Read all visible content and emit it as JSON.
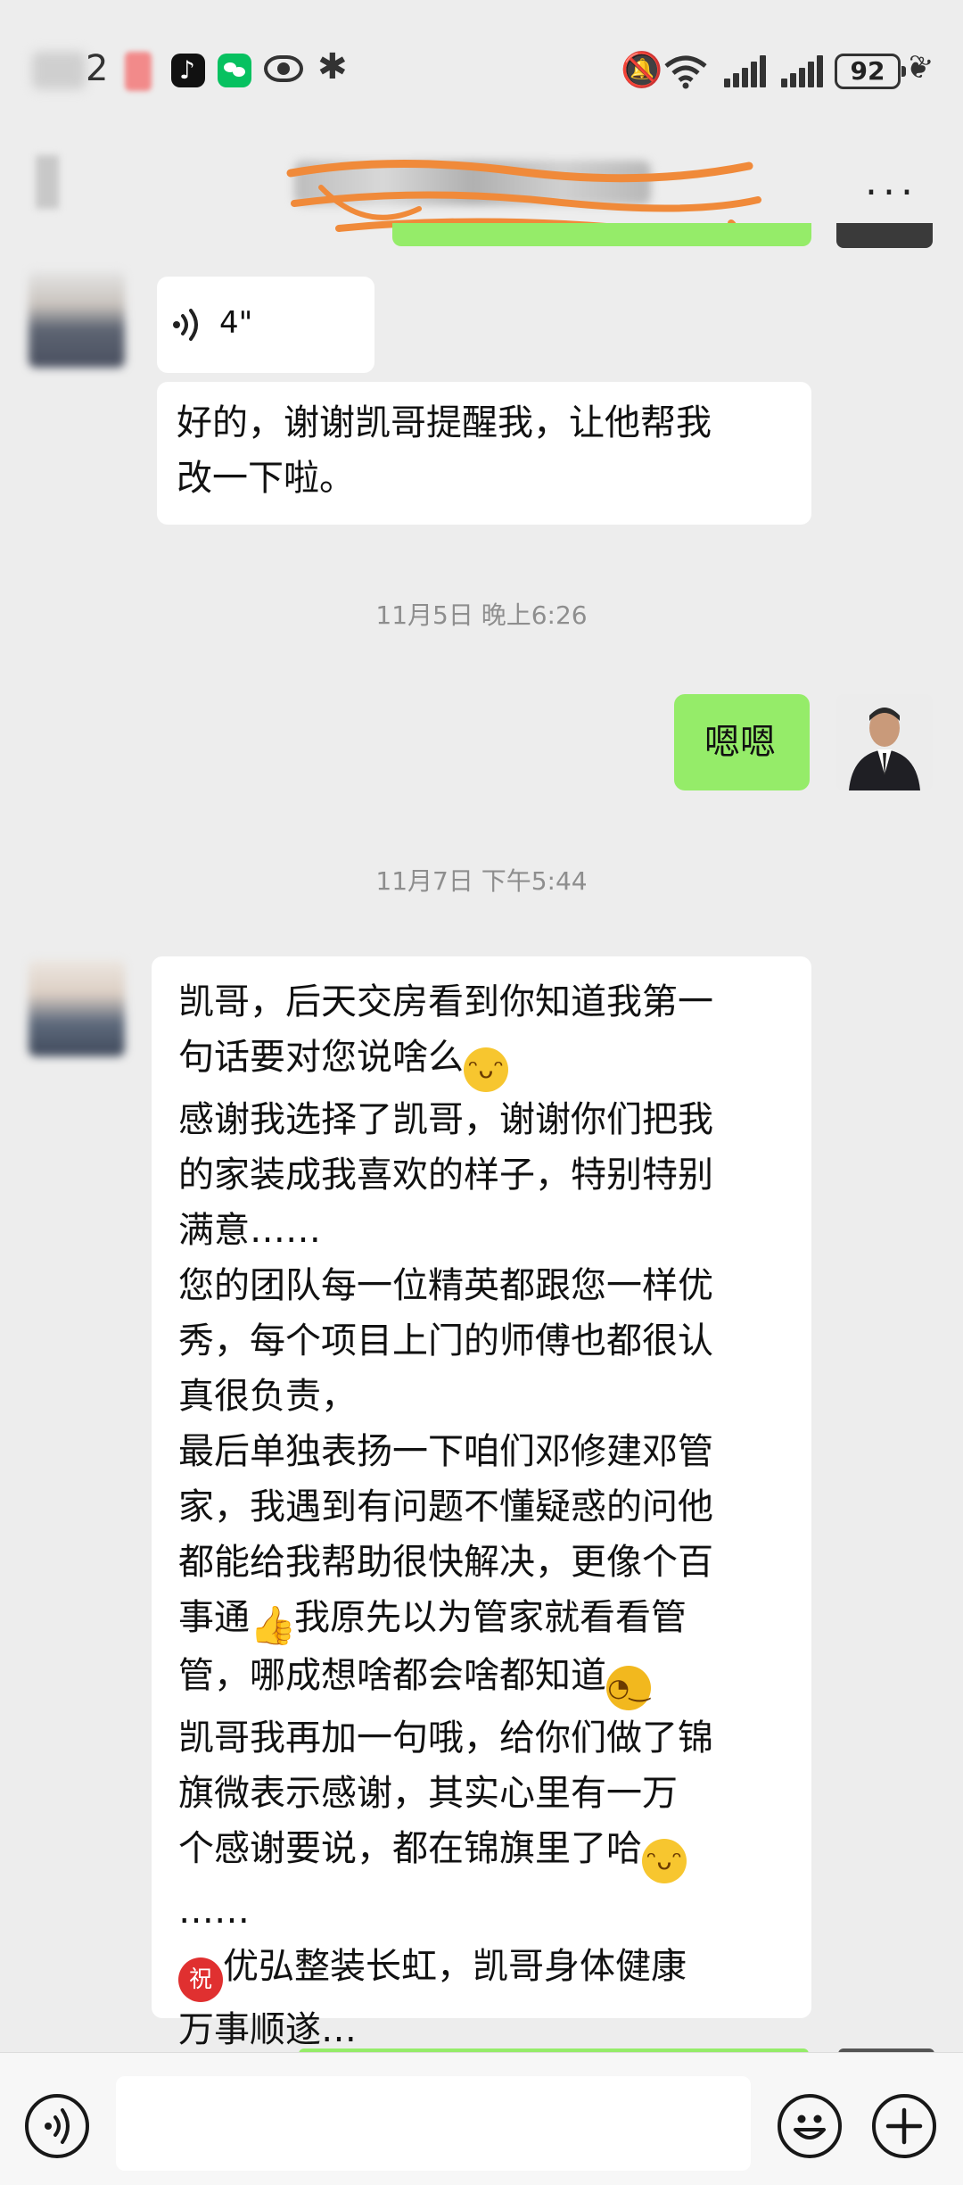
{
  "status_bar": {
    "time_visible": "2",
    "battery": "92"
  },
  "header": {
    "more_label": "..."
  },
  "messages": {
    "voice_duration": "4\"",
    "reply_1": "好的，谢谢凯哥提醒我，让他帮我\n改一下啦。",
    "time_1": "11月5日 晚上6:26",
    "self_reply": "嗯嗯",
    "time_2": "11月7日 下午5:44",
    "long": {
      "p1": "凯哥，后天交房看到你知道我第一\n句话要对您说啥么",
      "p2": "感谢我选择了凯哥，谢谢你们把我\n的家装成我喜欢的样子，特别特别\n满意……\n您的团队每一位精英都跟您一样优\n秀，每个项目上门的师傅也都很认\n真很负责，\n最后单独表扬一下咱们邓修建邓管\n家，我遇到有问题不懂疑惑的问他\n都能给我帮助很快解决，更像个百\n事通",
      "p3": "我原先以为管家就看看管\n管，哪成想啥都会啥都知道",
      "p4": "\n凯哥我再加一句哦，给你们做了锦\n旗微表示感谢，其实心里有一万\n个感谢要说，都在锦旗里了哈",
      "p5": "\n……\n",
      "p6": "优弘整装长虹，凯哥身体健康\n万事顺遂…"
    },
    "emoji": {
      "grin": "grinning-face",
      "thumb": "thumbs-up",
      "think": "thinking-face",
      "zhu": "祝"
    }
  },
  "input_bar": {
    "placeholder": ""
  },
  "colors": {
    "background": "#ededed",
    "bubble_self": "#95ec69",
    "bubble_other": "#ffffff",
    "timestamp": "#8e8e8e"
  }
}
